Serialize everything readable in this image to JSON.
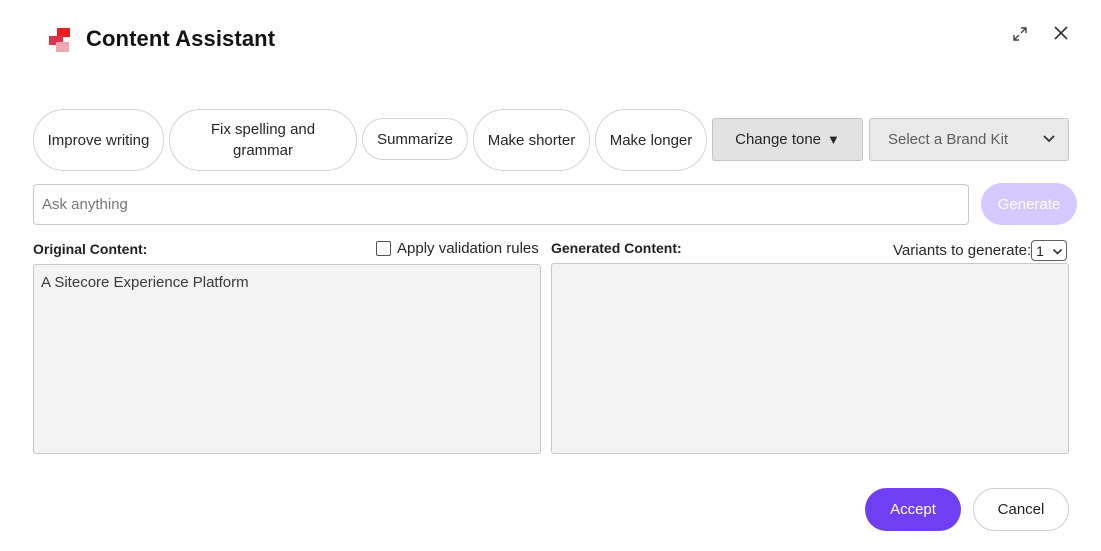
{
  "header": {
    "title": "Content Assistant",
    "logo_icon": "sitecore-logo-icon",
    "brand_color": "#eb1f1f",
    "expand_icon": "expand-icon",
    "close_icon": "close-icon"
  },
  "actions": {
    "improve_writing": "Improve writing",
    "fix_spelling": "Fix spelling and grammar",
    "summarize": "Summarize",
    "make_shorter": "Make shorter",
    "make_longer": "Make longer",
    "change_tone": "Change tone",
    "change_tone_caret": "▼",
    "brand_kit_placeholder": "Select a Brand Kit"
  },
  "prompt": {
    "placeholder": "Ask anything",
    "value": "",
    "generate_label": "Generate",
    "generate_color": "#d5c9fd"
  },
  "original": {
    "label": "Original Content:",
    "apply_validation_label": "Apply validation rules",
    "apply_validation_checked": false,
    "content": "A Sitecore Experience Platform"
  },
  "generated": {
    "label": "Generated Content:",
    "variants_label": "Variants to generate:",
    "variants_value": "1",
    "content": ""
  },
  "footer": {
    "accept_label": "Accept",
    "accept_color": "#6e3ff3",
    "cancel_label": "Cancel"
  }
}
